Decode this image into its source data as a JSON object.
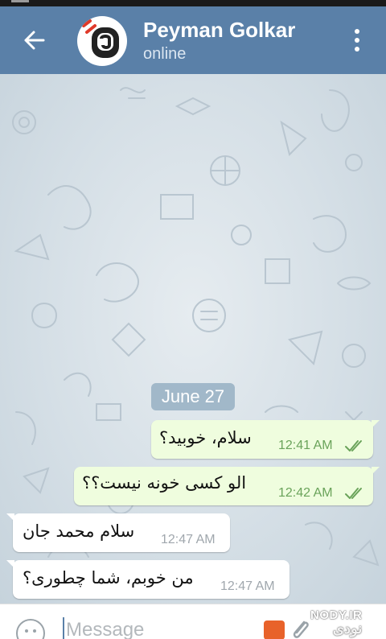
{
  "header": {
    "contact_name": "Peyman Golkar",
    "status": "online",
    "accent_color": "#5a80a8"
  },
  "chat": {
    "date_label": "June 27",
    "messages": [
      {
        "direction": "outgoing",
        "text": "سلام، خوبید؟",
        "time": "12:41 AM",
        "read": true
      },
      {
        "direction": "outgoing",
        "text": "الو کسی خونه نیست؟؟",
        "time": "12:42 AM",
        "read": true
      },
      {
        "direction": "incoming",
        "text": "سلام محمد جان",
        "time": "12:47 AM"
      },
      {
        "direction": "incoming",
        "text": "من خوبم، شما چطوری؟",
        "time": "12:47 AM"
      }
    ]
  },
  "composer": {
    "placeholder": "Message"
  },
  "watermark": {
    "site": "NODY.IR",
    "text": "نودی"
  },
  "icons": {
    "back": "arrow-left-icon",
    "menu": "more-vertical-icon",
    "emoji": "emoji-icon",
    "attach": "paperclip-icon",
    "read": "double-check-icon"
  }
}
